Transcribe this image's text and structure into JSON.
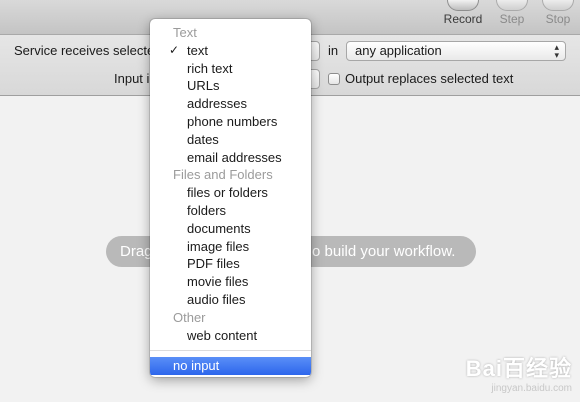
{
  "toolbar": {
    "record": "Record",
    "step": "Step",
    "stop": "Stop"
  },
  "config": {
    "service_label": "Service receives selecte",
    "in_label": "in",
    "app_value": "any application",
    "input_label": "Input i",
    "output_label": "Output replaces selected text"
  },
  "hint": {
    "left": "Drag",
    "right": "o build your workflow."
  },
  "menu": {
    "header_text": "Text",
    "items_text": [
      "text",
      "rich text",
      "URLs",
      "addresses",
      "phone numbers",
      "dates",
      "email addresses"
    ],
    "header_files": "Files and Folders",
    "items_files": [
      "files or folders",
      "folders",
      "documents",
      "image files",
      "PDF files",
      "movie files",
      "audio files"
    ],
    "header_other": "Other",
    "items_other": [
      "web content"
    ],
    "selected": "no input",
    "checkmark": "✓"
  },
  "watermark": {
    "logo": "Bai百经验",
    "url": "jingyan.baidu.com"
  },
  "colors": {
    "highlight": "#2d66ec",
    "hint_bg": "#b9b9b9"
  }
}
